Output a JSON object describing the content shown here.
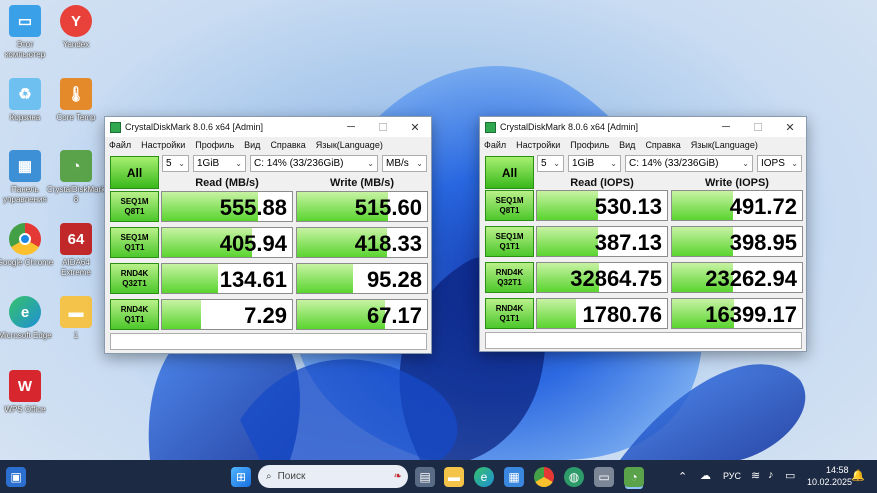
{
  "desktop_icons": [
    {
      "label": "Этот компьютер",
      "icon": "monitor-icon",
      "color": "#3aa0e8"
    },
    {
      "label": "Yandex",
      "icon": "yandex-icon",
      "color": "#e8413a"
    },
    {
      "label": "Корзина",
      "icon": "recycle-bin-icon",
      "color": "#6ec0f0"
    },
    {
      "label": "Core Temp",
      "icon": "thermometer-icon",
      "color": "#e58a2a"
    },
    {
      "label": "Панель управления",
      "icon": "control-panel-icon",
      "color": "#3d8fd6"
    },
    {
      "label": "CrystalDiskMark 8",
      "icon": "crystaldiskmark-icon",
      "color": "#5aa34a"
    },
    {
      "label": "Google Chrome",
      "icon": "chrome-icon",
      "color": "#4caf50"
    },
    {
      "label": "AIDA64 Extreme",
      "icon": "aida64-icon",
      "color": "#c0282a"
    },
    {
      "label": "Microsoft Edge",
      "icon": "edge-icon",
      "color": "#1e8fd6"
    },
    {
      "label": "1",
      "icon": "folder-icon",
      "color": "#f3c34a"
    },
    {
      "label": "WPS Office",
      "icon": "wps-icon",
      "color": "#d7262e"
    }
  ],
  "window_left": {
    "title": "CrystalDiskMark 8.0.6 x64 [Admin]",
    "menu": [
      "Файл",
      "Настройки",
      "Профиль",
      "Вид",
      "Справка",
      "Язык(Language)"
    ],
    "count": "5",
    "size": "1GiB",
    "drive": "C: 14% (33/236GiB)",
    "unit": "MB/s",
    "all_label": "All",
    "read_header": "Read (MB/s)",
    "write_header": "Write (MB/s)",
    "rows": [
      {
        "l1": "SEQ1M",
        "l2": "Q8T1",
        "read": "555.88",
        "write": "515.60",
        "read_fill": 0.74,
        "write_fill": 0.7
      },
      {
        "l1": "SEQ1M",
        "l2": "Q1T1",
        "read": "405.94",
        "write": "418.33",
        "read_fill": 0.69,
        "write_fill": 0.69
      },
      {
        "l1": "RND4K",
        "l2": "Q32T1",
        "read": "134.61",
        "write": "95.28",
        "read_fill": 0.43,
        "write_fill": 0.43
      },
      {
        "l1": "RND4K",
        "l2": "Q1T1",
        "read": "7.29",
        "write": "67.17",
        "read_fill": 0.3,
        "write_fill": 0.68
      }
    ]
  },
  "window_right": {
    "title": "CrystalDiskMark 8.0.6 x64 [Admin]",
    "menu": [
      "Файл",
      "Настройки",
      "Профиль",
      "Вид",
      "Справка",
      "Язык(Language)"
    ],
    "count": "5",
    "size": "1GiB",
    "drive": "C: 14% (33/236GiB)",
    "unit": "IOPS",
    "all_label": "All",
    "read_header": "Read (IOPS)",
    "write_header": "Write (IOPS)",
    "rows": [
      {
        "l1": "SEQ1M",
        "l2": "Q8T1",
        "read": "530.13",
        "write": "491.72",
        "read_fill": 0.47,
        "write_fill": 0.47
      },
      {
        "l1": "SEQ1M",
        "l2": "Q1T1",
        "read": "387.13",
        "write": "398.95",
        "read_fill": 0.47,
        "write_fill": 0.47
      },
      {
        "l1": "RND4K",
        "l2": "Q32T1",
        "read": "32864.75",
        "write": "23262.94",
        "read_fill": 0.48,
        "write_fill": 0.47
      },
      {
        "l1": "RND4K",
        "l2": "Q1T1",
        "read": "1780.76",
        "write": "16399.17",
        "read_fill": 0.3,
        "write_fill": 0.48
      }
    ]
  },
  "taskbar": {
    "search_placeholder": "Поиск",
    "language": "РУС",
    "time": "14:58",
    "date": "10.02.2025"
  }
}
